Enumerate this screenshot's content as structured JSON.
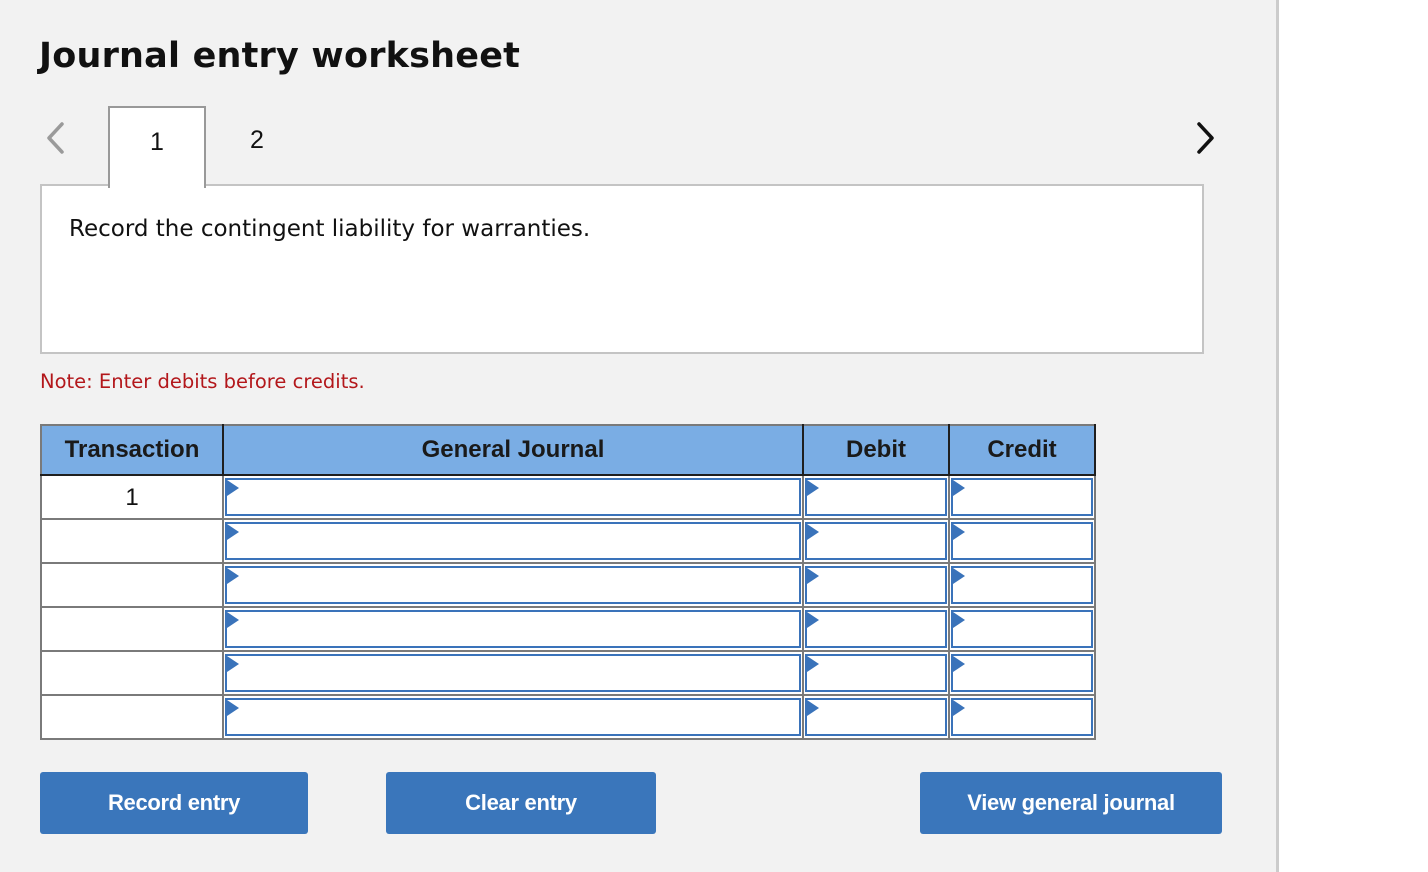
{
  "header": {
    "title": "Journal entry worksheet"
  },
  "nav": {
    "prev_icon": "chevron-left-icon",
    "next_icon": "chevron-right-icon",
    "tabs": [
      {
        "label": "1",
        "active": true
      },
      {
        "label": "2",
        "active": false
      }
    ]
  },
  "prompt": {
    "text": "Record the contingent liability for warranties."
  },
  "note": {
    "text": "Note: Enter debits before credits."
  },
  "journal": {
    "columns": [
      "Transaction",
      "General Journal",
      "Debit",
      "Credit"
    ],
    "rows": [
      {
        "transaction": "1",
        "account": "",
        "debit": "",
        "credit": ""
      },
      {
        "transaction": "",
        "account": "",
        "debit": "",
        "credit": ""
      },
      {
        "transaction": "",
        "account": "",
        "debit": "",
        "credit": ""
      },
      {
        "transaction": "",
        "account": "",
        "debit": "",
        "credit": ""
      },
      {
        "transaction": "",
        "account": "",
        "debit": "",
        "credit": ""
      },
      {
        "transaction": "",
        "account": "",
        "debit": "",
        "credit": ""
      }
    ]
  },
  "buttons": {
    "record": "Record entry",
    "clear": "Clear entry",
    "view": "View general journal"
  },
  "colors": {
    "header_blue": "#7aade4",
    "button_blue": "#3a76bb",
    "field_border": "#3a73ba",
    "note_red": "#b3171b",
    "panel_bg": "#f2f2f2"
  }
}
